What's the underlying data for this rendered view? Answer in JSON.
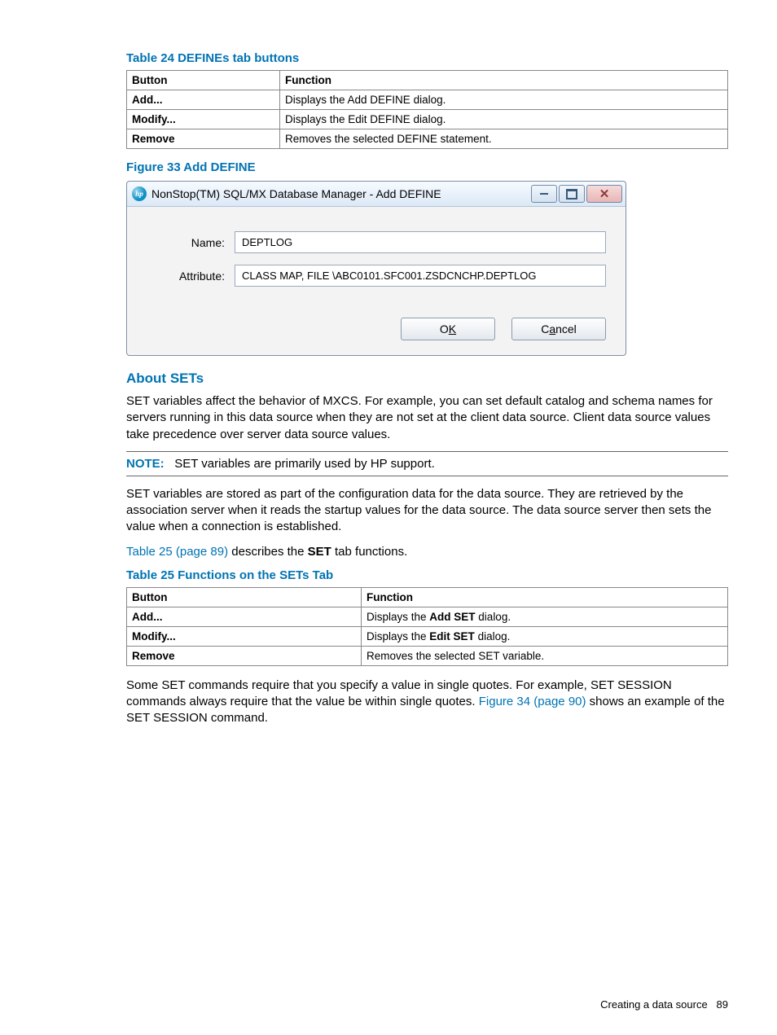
{
  "table24": {
    "caption": "Table 24 DEFINEs tab buttons",
    "headers": [
      "Button",
      "Function"
    ],
    "rows": [
      {
        "button": "Add...",
        "func": "Displays the Add DEFINE dialog."
      },
      {
        "button": "Modify...",
        "func": "Displays the Edit DEFINE dialog."
      },
      {
        "button": "Remove",
        "func": "Removes the selected DEFINE statement."
      }
    ]
  },
  "figure33": {
    "caption": "Figure 33 Add DEFINE",
    "title": "NonStop(TM) SQL/MX Database Manager - Add DEFINE",
    "name_label": "Name:",
    "name_value": "DEPTLOG",
    "attr_label": "Attribute:",
    "attr_value": "CLASS MAP, FILE \\ABC0101.SFC001.ZSDCNCHP.DEPTLOG",
    "ok_pre": "O",
    "ok_ul": "K",
    "cancel_pre": "C",
    "cancel_ul": "a",
    "cancel_post": "ncel"
  },
  "about_sets": {
    "heading": "About SETs",
    "p1": "SET variables affect the behavior of MXCS. For example, you can set default catalog and schema names for servers running in this data source when they are not set at the client data source. Client data source values take precedence over server data source values.",
    "note_label": "NOTE:",
    "note_text": "SET variables are primarily used by HP support.",
    "p2": "SET variables are stored as part of the configuration data for the data source. They are retrieved by the association server when it reads the startup values for the data source. The data source server then sets the value when a connection is established.",
    "p3_link": "Table 25 (page 89)",
    "p3_mid": " describes the ",
    "p3_bold": "SET",
    "p3_end": " tab functions."
  },
  "table25": {
    "caption": "Table 25 Functions on the SETs Tab",
    "headers": [
      "Button",
      "Function"
    ],
    "rows": [
      {
        "button": "Add...",
        "f_pre": "Displays the ",
        "f_bold": "Add SET",
        "f_post": " dialog."
      },
      {
        "button": "Modify...",
        "f_pre": "Displays the ",
        "f_bold": "Edit SET",
        "f_post": " dialog."
      },
      {
        "button": "Remove",
        "f_pre": "Removes the selected SET variable.",
        "f_bold": "",
        "f_post": ""
      }
    ]
  },
  "trailing": {
    "pre": "Some SET commands require that you specify a value in single quotes. For example, SET SESSION commands always require that the value be within single quotes. ",
    "link": "Figure 34 (page 90)",
    "post": " shows an example of the SET SESSION command."
  },
  "footer": {
    "section": "Creating a data source",
    "page": "89"
  }
}
